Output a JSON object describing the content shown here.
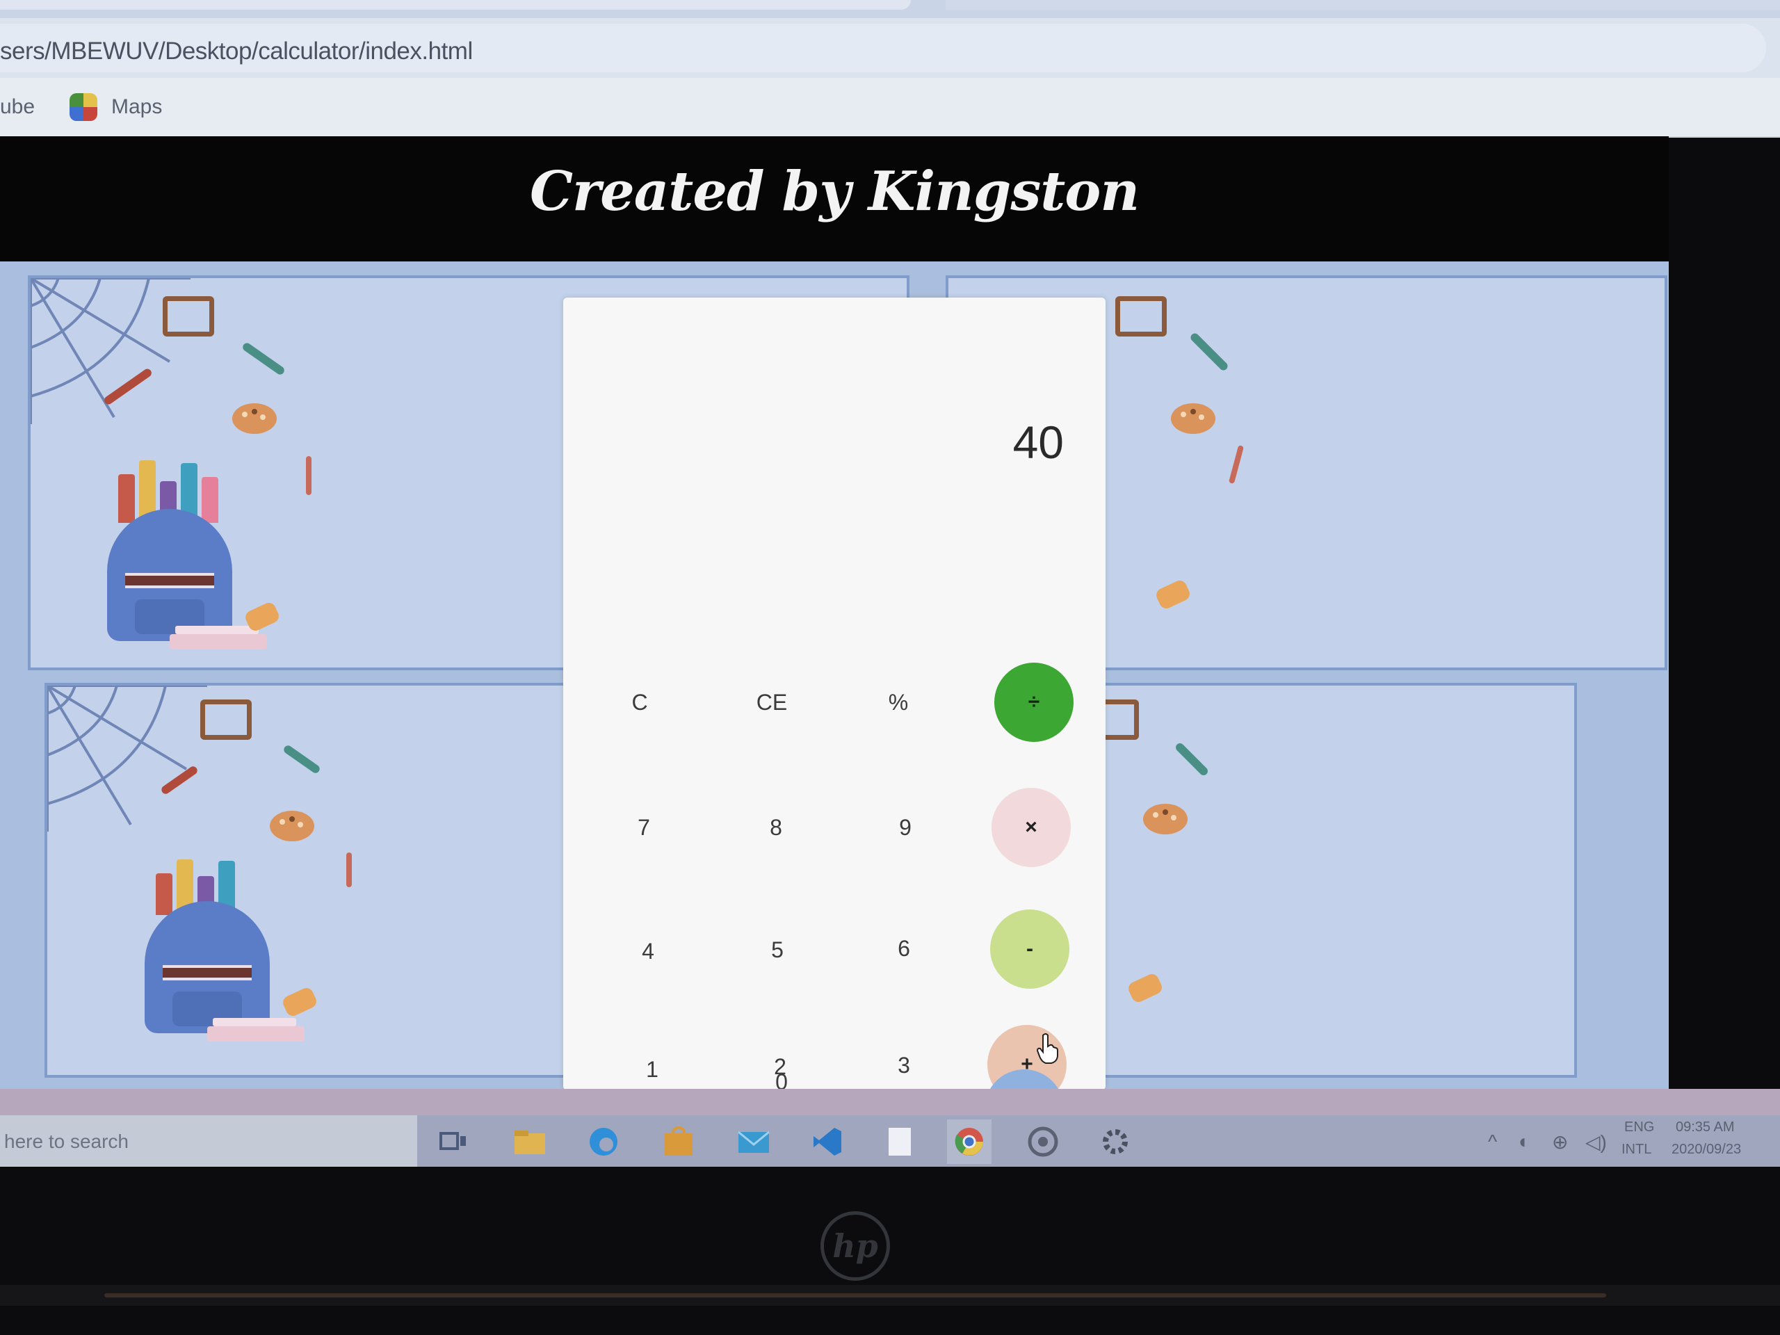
{
  "browser": {
    "url": "sers/MBEWUV/Desktop/calculator/index.html",
    "bookmarks": [
      {
        "label": "ube"
      },
      {
        "label": "Maps"
      }
    ]
  },
  "page": {
    "banner_title": "Created by Kingston"
  },
  "calculator": {
    "display": "40",
    "keys": {
      "clear": "C",
      "clear_entry": "CE",
      "percent": "%",
      "divide": "÷",
      "seven": "7",
      "eight": "8",
      "nine": "9",
      "multiply": "×",
      "four": "4",
      "five": "5",
      "six": "6",
      "subtract": "-",
      "one": "1",
      "two": "2",
      "three": "3",
      "add": "+",
      "zero": "0",
      "equals": "="
    },
    "colors": {
      "divide": "#3ca733",
      "multiply": "#f1d9dc",
      "subtract": "#c9df8e",
      "add": "#ebc4b0",
      "equals": "#8fb1e0"
    }
  },
  "taskbar": {
    "search_placeholder": "here to search",
    "apps": [
      "task-view-icon",
      "file-explorer-icon",
      "edge-icon",
      "store-icon",
      "mail-icon",
      "vscode-icon",
      "notepad-icon",
      "chrome-icon",
      "cortana-icon",
      "settings-icon"
    ],
    "tray": {
      "language": "ENG",
      "region": "INTL",
      "time": "09:35 AM",
      "date": "2020/09/23"
    }
  },
  "device": {
    "logo": "hp"
  }
}
